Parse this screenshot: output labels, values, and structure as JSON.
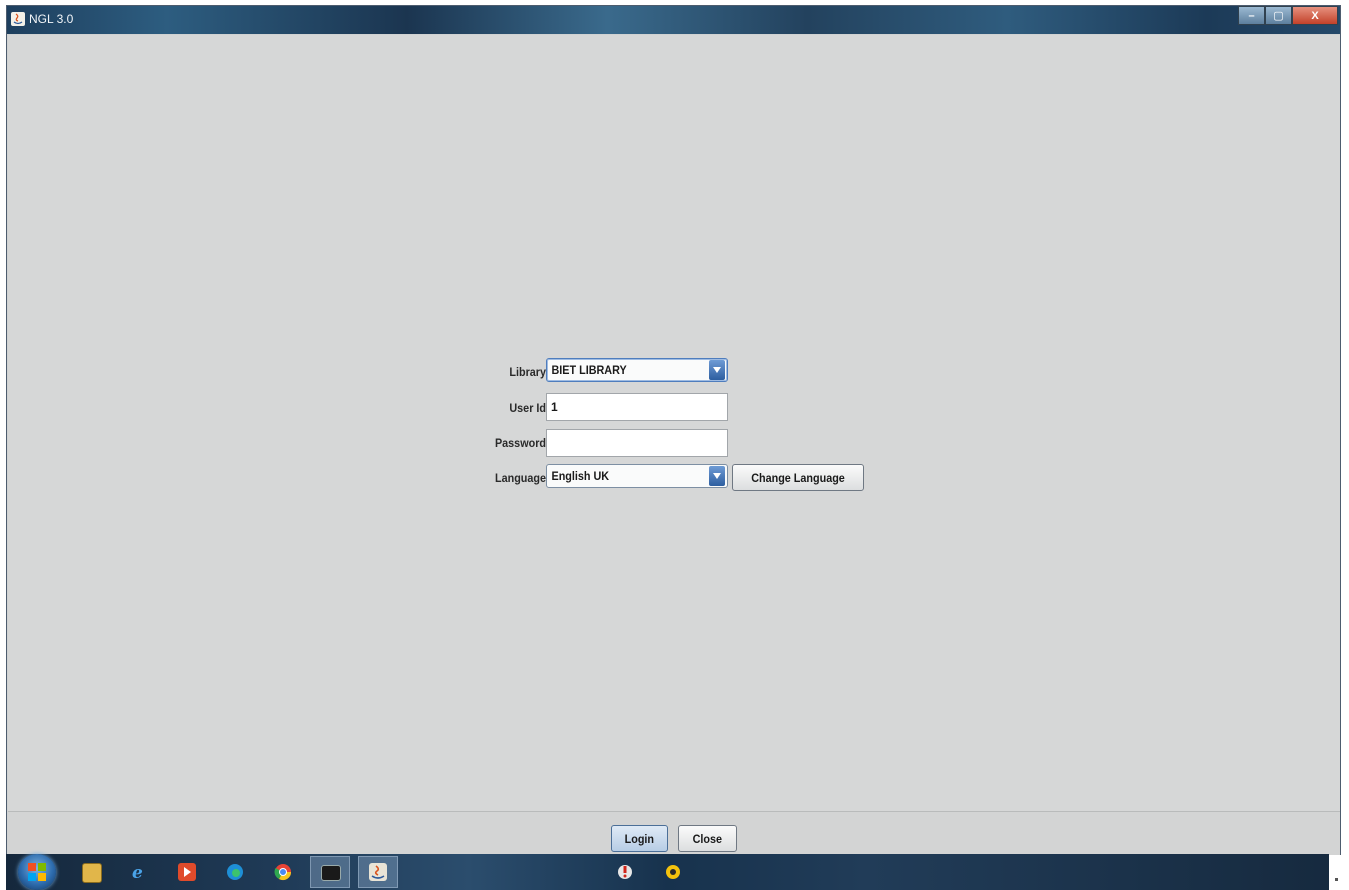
{
  "window": {
    "title": "NGL 3.0",
    "controls": {
      "minimize": "–",
      "maximize": "▢",
      "close": "X"
    }
  },
  "login": {
    "library_label": "Library",
    "library_value": "BIET LIBRARY",
    "userid_label": "User Id",
    "userid_value": "1",
    "password_label": "Password",
    "password_value": "",
    "language_label": "Language",
    "language_value": "English UK",
    "change_language_button": "Change Language"
  },
  "footer": {
    "login_button": "Login",
    "close_button": "Close"
  },
  "taskbar": {
    "items": [
      "start-orb",
      "file-explorer-icon",
      "internet-explorer-icon",
      "media-player-icon",
      "edge-icon",
      "chrome-icon",
      "terminal-icon",
      "java-app-icon",
      "pdf-reader-icon",
      "norton-icon"
    ]
  },
  "colors": {
    "window_bg": "#d6d7d7",
    "title_bar": "#24496a",
    "combo_arrow": "#2d5ea0",
    "close_button_red": "#c3412a"
  }
}
